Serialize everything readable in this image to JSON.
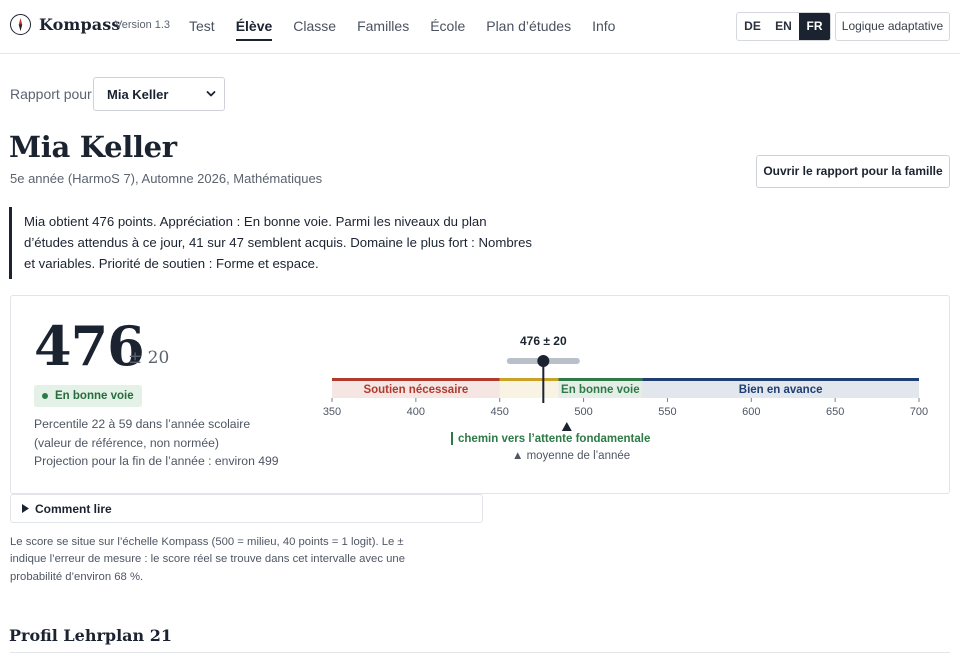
{
  "app": {
    "name": "Kompass",
    "version": "Version 1.3"
  },
  "nav": {
    "tabs": [
      {
        "label": "Test"
      },
      {
        "label": "Élève"
      },
      {
        "label": "Classe"
      },
      {
        "label": "Familles"
      },
      {
        "label": "École"
      },
      {
        "label": "Plan d’études"
      },
      {
        "label": "Info"
      }
    ],
    "active_tab": "Élève"
  },
  "languages": {
    "options": [
      "DE",
      "EN",
      "FR"
    ],
    "selected": "FR"
  },
  "adaptive_button": "Logique adaptative",
  "report": {
    "label": "Rapport pour",
    "selected_student": "Mia Keller"
  },
  "student": {
    "name": "Mia Keller",
    "subtitle": "5e année (HarmoS 7), Automne 2026, Mathématiques"
  },
  "family_button": "Ouvrir le rapport pour la famille",
  "summary": "Mia obtient 476 points. Appréciation : En bonne voie. Parmi les niveaux du plan d’études attendus à ce jour, 41 sur 47 semblent acquis. Domaine le plus fort : Nombres et variables. Priorité de soutien : Forme et espace.",
  "score": {
    "value": "476",
    "error": "± 20",
    "badge": "En bonne voie",
    "percentile": "Percentile 22 à 59 dans l’année scolaire (valeur de référence, non normée)",
    "projection": "Projection pour la fin de l’année : environ 499"
  },
  "scale": {
    "score_label": "476 ± 20",
    "score": 476,
    "error": 20,
    "min": 350,
    "max": 700,
    "ticks": [
      350,
      400,
      450,
      500,
      550,
      600,
      650,
      700
    ],
    "bands": [
      {
        "label": "Soutien nécessaire",
        "from": 350,
        "to": 450,
        "color": "#b03a2e"
      },
      {
        "label": "",
        "from": 450,
        "to": 485,
        "color": "#c9a227"
      },
      {
        "label": "En bonne voie",
        "from": 485,
        "to": 535,
        "color": "#2d7a47"
      },
      {
        "label": "Bien en avance",
        "from": 535,
        "to": 700,
        "color": "#1f3f73"
      }
    ],
    "year_mean": 490,
    "path_marker": "chemin vers l’attente fondamentale",
    "mean_legend": "▲ moyenne de l’année",
    "colors": {
      "accent": "#1b2330",
      "path": "#2d7a47",
      "ci": "#b9c0ca"
    }
  },
  "howto": {
    "label": "Comment lire",
    "expanded": false
  },
  "footnote": "Le score se situe sur l’échelle Kompass (500 = milieu, 40 points = 1 logit). Le ± indique l’erreur de mesure : le score réel se trouve dans cet intervalle avec une probabilité d’environ 68 %.",
  "section": {
    "title": "Profil Lehrplan 21"
  }
}
